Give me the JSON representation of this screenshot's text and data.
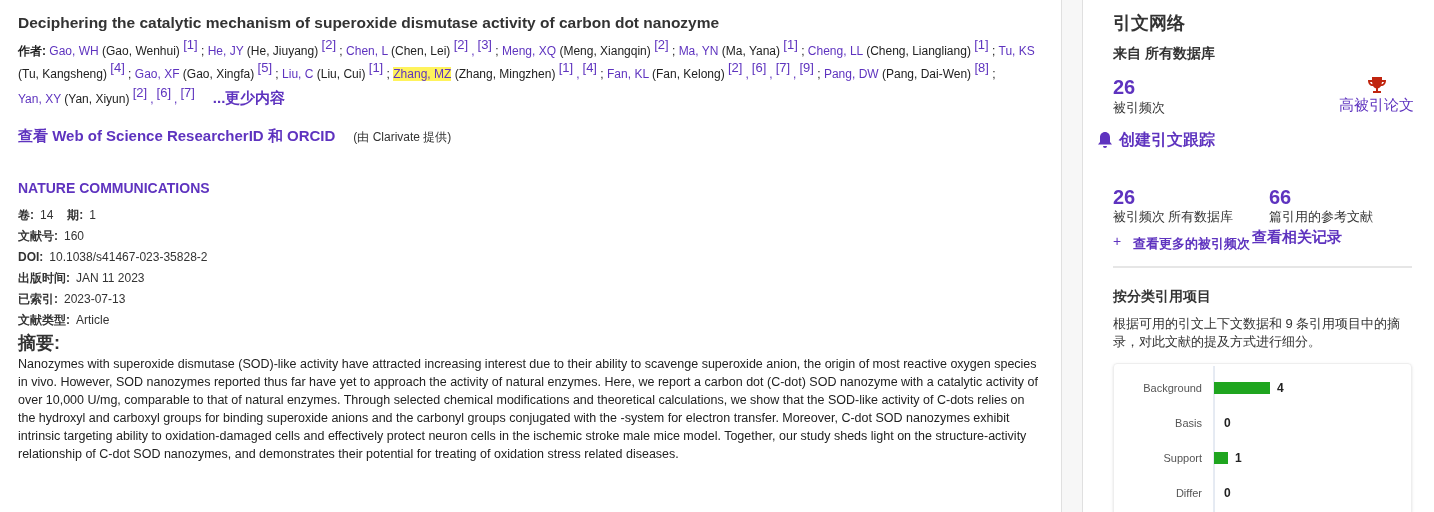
{
  "record": {
    "title": "Deciphering the catalytic mechanism of superoxide dismutase activity of carbon dot nanozyme",
    "authors_label": "作者:",
    "author_separator": ";",
    "ref_separator": ",",
    "authors": [
      {
        "short": "Gao, WH",
        "full": "(Gao, Wenhui)",
        "refs": [
          "[1]"
        ],
        "highlighted": false
      },
      {
        "short": "He, JY",
        "full": "(He, Jiuyang)",
        "refs": [
          "[2]"
        ],
        "highlighted": false
      },
      {
        "short": "Chen, L",
        "full": "(Chen, Lei)",
        "refs": [
          "[2]",
          "[3]"
        ],
        "highlighted": false
      },
      {
        "short": "Meng, XQ",
        "full": "(Meng, Xiangqin)",
        "refs": [
          "[2]"
        ],
        "highlighted": false
      },
      {
        "short": "Ma, YN",
        "full": "(Ma, Yana)",
        "refs": [
          "[1]"
        ],
        "highlighted": false
      },
      {
        "short": "Cheng, LL",
        "full": "(Cheng, Liangliang)",
        "refs": [
          "[1]"
        ],
        "highlighted": false
      },
      {
        "short": "Tu, KS",
        "full": "(Tu, Kangsheng)",
        "refs": [
          "[4]"
        ],
        "highlighted": false
      },
      {
        "short": "Gao, XF",
        "full": "(Gao, Xingfa)",
        "refs": [
          "[5]"
        ],
        "highlighted": false
      },
      {
        "short": "Liu, C",
        "full": "(Liu, Cui)",
        "refs": [
          "[1]"
        ],
        "highlighted": false
      },
      {
        "short": "Zhang, MZ",
        "full": "(Zhang, Mingzhen)",
        "refs": [
          "[1]",
          "[4]"
        ],
        "highlighted": true
      },
      {
        "short": "Fan, KL",
        "full": "(Fan, Kelong)",
        "refs": [
          "[2]",
          "[6]",
          "[7]",
          "[9]"
        ],
        "highlighted": false
      },
      {
        "short": "Pang, DW",
        "full": "(Pang, Dai-Wen)",
        "refs": [
          "[8]"
        ],
        "highlighted": false
      },
      {
        "short": "Yan, XY",
        "full": "(Yan, Xiyun)",
        "refs": [
          "[2]",
          "[6]",
          "[7]"
        ],
        "highlighted": false
      }
    ],
    "less_link": "...更少内容",
    "researcher_link": "查看 Web of Science ResearcherID 和 ORCID",
    "provided_by": "(由 Clarivate 提供)",
    "journal": "NATURE COMMUNICATIONS",
    "volume_label": "卷:",
    "volume": "14",
    "issue_label": "期:",
    "issue": "1",
    "fields": [
      {
        "label": "文献号:",
        "value": "160"
      },
      {
        "label": "DOI:",
        "value": "10.1038/s41467-023-35828-2"
      },
      {
        "label": "出版时间:",
        "value": "JAN 11 2023"
      },
      {
        "label": "已索引:",
        "value": "2023-07-13"
      },
      {
        "label": "文献类型:",
        "value": "Article"
      }
    ],
    "abstract_heading": "摘要:",
    "abstract": "Nanozymes with superoxide dismutase (SOD)-like activity have attracted increasing interest due to their ability to scavenge superoxide anion, the origin of most reactive oxygen species in vivo. However, SOD nanozymes reported thus far have yet to approach the activity of natural enzymes. Here, we report a carbon dot (C-dot) SOD nanozyme with a catalytic activity of over 10,000 U/mg, comparable to that of natural enzymes. Through selected chemical modifications and theoretical calculations, we show that the SOD-like activity of C-dots relies on the hydroxyl and carboxyl groups for binding superoxide anions and the carbonyl groups conjugated with the -system for electron transfer. Moreover, C-dot SOD nanozymes exhibit intrinsic targeting ability to oxidation-damaged cells and effectively protect neuron cells in the ischemic stroke male mice model. Together, our study sheds light on the structure-activity relationship of C-dot SOD nanozymes, and demonstrates their potential for treating of oxidation stress related diseases."
  },
  "sidebar": {
    "title": "引文网络",
    "source": "来自 所有数据库",
    "times_cited": "26",
    "times_cited_label": "被引频次",
    "highly_cited": "高被引论文",
    "alert_link": "创建引文跟踪",
    "stats": [
      {
        "value": "26",
        "label": "被引频次 所有数据库"
      },
      {
        "value": "66",
        "label": "篇引用的参考文献"
      }
    ],
    "more_link_icon": "+",
    "more_link": "查看更多的被引频次",
    "related_link": "查看相关记录",
    "classification_title": "按分类引用项目",
    "classification_desc": "根据可用的引文上下文数据和 9 条引用项目中的摘录，对此文献的提及方式进行细分。",
    "chart_data": {
      "type": "bar",
      "orientation": "horizontal",
      "categories": [
        "Background",
        "Basis",
        "Support",
        "Differ"
      ],
      "series": [
        {
          "color": "#1fa51f",
          "values": [
            4,
            0,
            1,
            0
          ]
        }
      ],
      "data_labels": true
    }
  }
}
